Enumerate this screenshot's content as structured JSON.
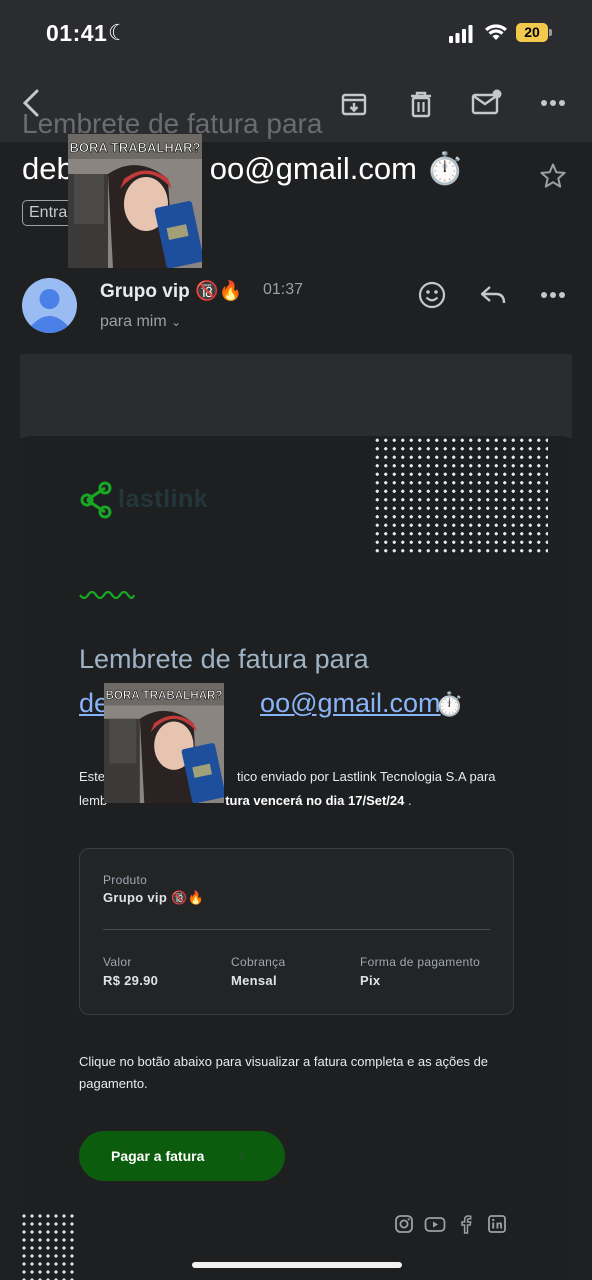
{
  "status_bar": {
    "time": "01:41",
    "battery": "20"
  },
  "header": {
    "subject_ghost": "Lembrete de fatura para",
    "subject": "deb",
    "subject_end": "oo@gmail.com ⏱️",
    "inbox_label": "Entrada"
  },
  "sticker": {
    "caption": "BORA TRABALHAR?"
  },
  "sender": {
    "name": "Grupo vip 🔞🔥",
    "time": "01:37",
    "to": "para mim"
  },
  "email": {
    "logo": "lastlink",
    "heading": "Lembrete de fatura para",
    "heading_email_start": "de",
    "heading_email_end": "oo@gmail.com",
    "heading_emoji": "⏱️",
    "body_line1_start": "Este",
    "body_line1_end": "tico enviado por Lastlink Tecnologia S.A para",
    "body_line2_start": "lemb",
    "body_line2_bold": "tura vencerá no dia 17/Set/24",
    "body_line2_end": " .",
    "product_label": "Produto",
    "product_value": "Grupo vip 🔞🔥",
    "value_label": "Valor",
    "value_value": "R$ 29.90",
    "billing_label": "Cobrança",
    "billing_value": "Mensal",
    "payment_label": "Forma de pagamento",
    "payment_value": "Pix",
    "instruction": "Clique no botão abaixo para visualizar a fatura completa e as ações de pagamento.",
    "pay_button": "Pagar a fatura",
    "pay_arrow": "›"
  },
  "colors": {
    "accent_green": "#19a824",
    "button_green": "#0c5c0e",
    "link_blue": "#8ab4f8"
  }
}
